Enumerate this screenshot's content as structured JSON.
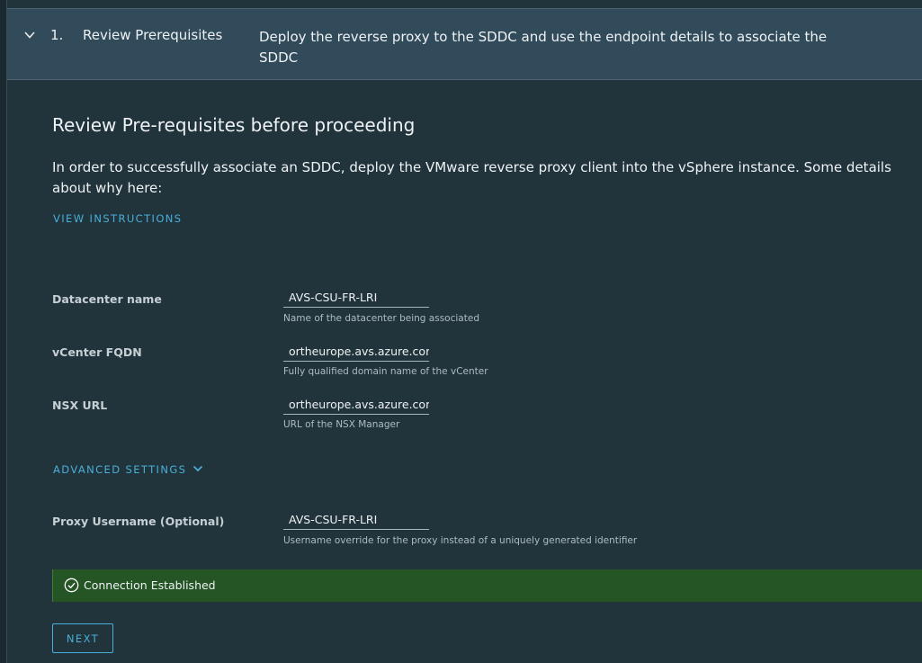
{
  "step": {
    "number": "1.",
    "title": "Review Prerequisites",
    "description": "Deploy the reverse proxy to the SDDC and use the endpoint details to associate the SDDC"
  },
  "content": {
    "heading": "Review Pre-requisites before proceeding",
    "intro": "In order to successfully associate an SDDC, deploy the VMware reverse proxy client into the vSphere instance. Some details about why here:",
    "view_instructions_label": "VIEW INSTRUCTIONS"
  },
  "form": {
    "datacenter": {
      "label": "Datacenter name",
      "value": "AVS-CSU-FR-LRI",
      "help": "Name of the datacenter being associated"
    },
    "vcenter": {
      "label": "vCenter FQDN",
      "value": "ortheurope.avs.azure.com",
      "help": "Fully qualified domain name of the vCenter"
    },
    "nsx": {
      "label": "NSX URL",
      "value": "ortheurope.avs.azure.com",
      "help": "URL of the NSX Manager"
    },
    "advanced_settings_label": "ADVANCED SETTINGS",
    "proxy_username": {
      "label": "Proxy Username (Optional)",
      "value": "AVS-CSU-FR-LRI",
      "help": "Username override for the proxy instead of a uniquely generated identifier"
    }
  },
  "status": {
    "message": "Connection Established",
    "icon": "check-circle-icon",
    "color": "#255525"
  },
  "actions": {
    "next_label": "NEXT"
  },
  "colors": {
    "background": "#21333b",
    "header": "#324b5b",
    "link": "#49afd9",
    "success": "#255525"
  }
}
